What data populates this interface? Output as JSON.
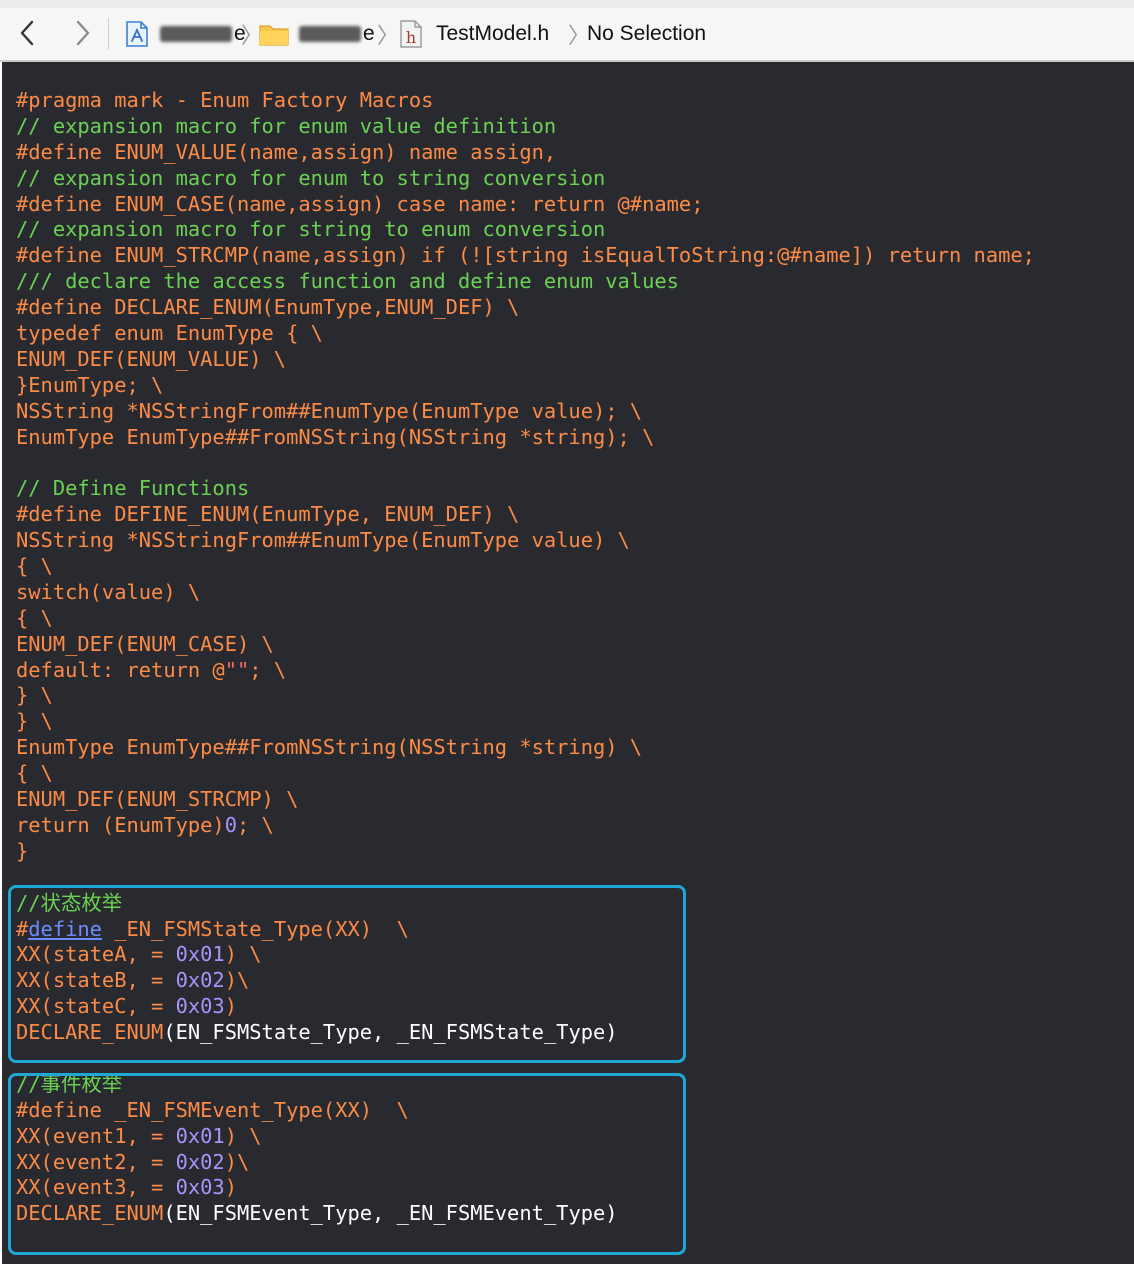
{
  "navbar": {
    "back_icon": "chevron-left-icon",
    "forward_icon": "chevron-right-icon",
    "breadcrumb": [
      {
        "icon": "app-project-icon",
        "label_suffix": "e"
      },
      {
        "icon": "folder-icon",
        "label_suffix": "e"
      },
      {
        "icon": "header-file-icon",
        "label": "TestModel.h"
      },
      {
        "label": "No Selection"
      }
    ]
  },
  "editor": {
    "theme_background": "#292a30",
    "colors": {
      "preprocessor": "#fc8b46",
      "comment": "#6bd152",
      "plain": "#ffffff",
      "string": "#fc6a5d",
      "number": "#a695fb",
      "link": "#6b8cff",
      "highlight_box": "#1fa8d6"
    },
    "lines": [
      [
        {
          "t": "#pragma mark - Enum Factory Macros",
          "c": "pre"
        }
      ],
      [
        {
          "t": "// expansion macro for enum value definition",
          "c": "com"
        }
      ],
      [
        {
          "t": "#define ENUM_VALUE(name,assign) name assign,",
          "c": "pre"
        }
      ],
      [
        {
          "t": "// expansion macro for enum to string conversion",
          "c": "com"
        }
      ],
      [
        {
          "t": "#define ENUM_CASE(name,assign) case name: return @#name;",
          "c": "pre"
        }
      ],
      [
        {
          "t": "// expansion macro for string to enum conversion",
          "c": "com"
        }
      ],
      [
        {
          "t": "#define ENUM_STRCMP(name,assign) if (![string isEqualToString:@#name]) return name;",
          "c": "pre"
        }
      ],
      [
        {
          "t": "/// declare the access function and define enum values",
          "c": "com"
        }
      ],
      [
        {
          "t": "#define DECLARE_ENUM(EnumType,ENUM_DEF) \\",
          "c": "pre"
        }
      ],
      [
        {
          "t": "typedef enum EnumType { \\",
          "c": "pre"
        }
      ],
      [
        {
          "t": "ENUM_DEF(ENUM_VALUE) \\",
          "c": "pre"
        }
      ],
      [
        {
          "t": "}EnumType; \\",
          "c": "pre"
        }
      ],
      [
        {
          "t": "NSString *NSStringFrom##EnumType(EnumType value); \\",
          "c": "pre"
        }
      ],
      [
        {
          "t": "EnumType EnumType##FromNSString(NSString *string); \\",
          "c": "pre"
        }
      ],
      [
        {
          "t": "",
          "c": "pre"
        }
      ],
      [
        {
          "t": "// Define Functions",
          "c": "com"
        }
      ],
      [
        {
          "t": "#define DEFINE_ENUM(EnumType, ENUM_DEF) \\",
          "c": "pre"
        }
      ],
      [
        {
          "t": "NSString *NSStringFrom##EnumType(EnumType value) \\",
          "c": "pre"
        }
      ],
      [
        {
          "t": "{ \\",
          "c": "pre"
        }
      ],
      [
        {
          "t": "switch(value) \\",
          "c": "pre"
        }
      ],
      [
        {
          "t": "{ \\",
          "c": "pre"
        }
      ],
      [
        {
          "t": "ENUM_DEF(ENUM_CASE) \\",
          "c": "pre"
        }
      ],
      [
        {
          "t": "default: return @",
          "c": "pre"
        },
        {
          "t": "\"\"",
          "c": "str"
        },
        {
          "t": "; \\",
          "c": "pre"
        }
      ],
      [
        {
          "t": "} \\",
          "c": "pre"
        }
      ],
      [
        {
          "t": "} \\",
          "c": "pre"
        }
      ],
      [
        {
          "t": "EnumType EnumType##FromNSString(NSString *string) \\",
          "c": "pre"
        }
      ],
      [
        {
          "t": "{ \\",
          "c": "pre"
        }
      ],
      [
        {
          "t": "ENUM_DEF(ENUM_STRCMP) \\",
          "c": "pre"
        }
      ],
      [
        {
          "t": "return (EnumType)",
          "c": "pre"
        },
        {
          "t": "0",
          "c": "num"
        },
        {
          "t": "; \\",
          "c": "pre"
        }
      ],
      [
        {
          "t": "}",
          "c": "pre"
        }
      ],
      [
        {
          "t": "",
          "c": "pre"
        }
      ],
      [
        {
          "t": "//状态枚举",
          "c": "com"
        }
      ],
      [
        {
          "t": "#",
          "c": "pre"
        },
        {
          "t": "define",
          "c": "link"
        },
        {
          "t": " _EN_FSMState_Type(XX)  \\",
          "c": "pre"
        }
      ],
      [
        {
          "t": "XX(stateA, = ",
          "c": "pre"
        },
        {
          "t": "0x01",
          "c": "num"
        },
        {
          "t": ") \\",
          "c": "pre"
        }
      ],
      [
        {
          "t": "XX(stateB, = ",
          "c": "pre"
        },
        {
          "t": "0x02",
          "c": "num"
        },
        {
          "t": ")\\",
          "c": "pre"
        }
      ],
      [
        {
          "t": "XX(stateC, = ",
          "c": "pre"
        },
        {
          "t": "0x03",
          "c": "num"
        },
        {
          "t": ")",
          "c": "pre"
        }
      ],
      [
        {
          "t": "DECLARE_ENUM",
          "c": "pre"
        },
        {
          "t": "(EN_FSMState_Type, _EN_FSMState_Type)",
          "c": "white"
        }
      ],
      [
        {
          "t": "",
          "c": "pre"
        }
      ],
      [
        {
          "t": "//事件枚举",
          "c": "com"
        }
      ],
      [
        {
          "t": "#define _EN_FSMEvent_Type(XX)  \\",
          "c": "pre"
        }
      ],
      [
        {
          "t": "XX(event1, = ",
          "c": "pre"
        },
        {
          "t": "0x01",
          "c": "num"
        },
        {
          "t": ") \\",
          "c": "pre"
        }
      ],
      [
        {
          "t": "XX(event2, = ",
          "c": "pre"
        },
        {
          "t": "0x02",
          "c": "num"
        },
        {
          "t": ")\\",
          "c": "pre"
        }
      ],
      [
        {
          "t": "XX(event3, = ",
          "c": "pre"
        },
        {
          "t": "0x03",
          "c": "num"
        },
        {
          "t": ")",
          "c": "pre"
        }
      ],
      [
        {
          "t": "DECLARE_ENUM",
          "c": "pre"
        },
        {
          "t": "(EN_FSMEvent_Type, _EN_FSMEvent_Type)",
          "c": "white"
        }
      ]
    ]
  }
}
